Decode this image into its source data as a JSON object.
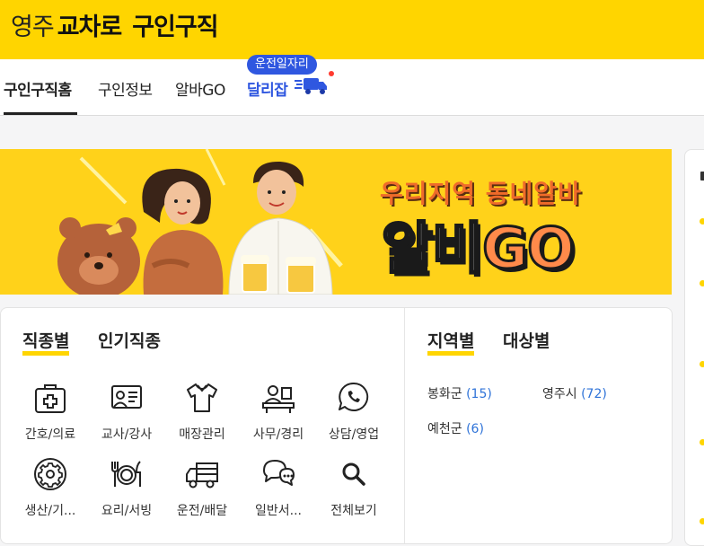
{
  "header": {
    "brand_part1": "영주",
    "brand_part2": "교차로",
    "brand_part3": "구인구직"
  },
  "nav": {
    "tabs": [
      {
        "label": "구인구직홈",
        "active": true
      },
      {
        "label": "구인정보"
      },
      {
        "label": "알바GO"
      },
      {
        "label": "달리잡"
      }
    ],
    "badge": "운전일자리",
    "new_dot_color": "#ff3b30"
  },
  "banner": {
    "tagline": "우리지역 동네알바",
    "title_white": "알비",
    "title_orange": "GO"
  },
  "categories": {
    "tabs": [
      "직종별",
      "인기직종"
    ],
    "items": [
      {
        "label": "간호/의료",
        "icon": "medical-kit-icon"
      },
      {
        "label": "교사/강사",
        "icon": "teacher-board-icon"
      },
      {
        "label": "매장관리",
        "icon": "shirt-icon"
      },
      {
        "label": "사무/경리",
        "icon": "office-desk-icon"
      },
      {
        "label": "상담/영업",
        "icon": "phone-chat-icon"
      },
      {
        "label": "생산/기...",
        "icon": "gear-icon"
      },
      {
        "label": "요리/서빙",
        "icon": "fork-plate-knife-icon"
      },
      {
        "label": "운전/배달",
        "icon": "truck-icon"
      },
      {
        "label": "일반서...",
        "icon": "speech-bubble-icon"
      },
      {
        "label": "전체보기",
        "icon": "search-icon"
      }
    ]
  },
  "regions": {
    "tabs": [
      "지역별",
      "대상별"
    ],
    "items": [
      {
        "name": "봉화군",
        "count": "(15)"
      },
      {
        "name": "영주시",
        "count": "(72)"
      },
      {
        "name": "예천군",
        "count": "(6)"
      }
    ]
  },
  "colors": {
    "brand_yellow": "#ffd500",
    "accent_blue": "#2f57e0",
    "count_blue": "#2f73d8"
  }
}
